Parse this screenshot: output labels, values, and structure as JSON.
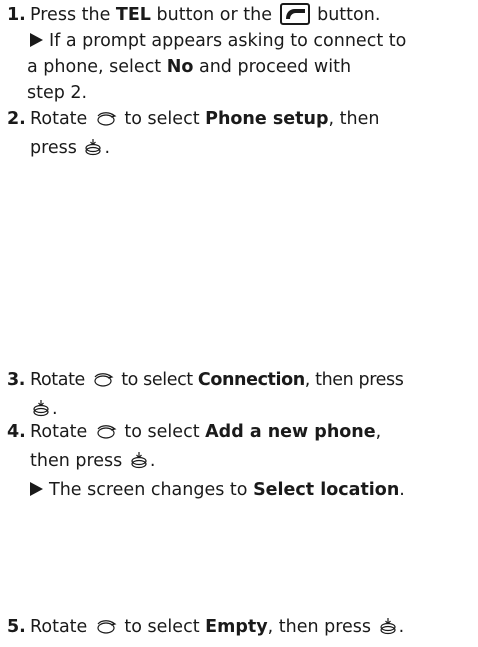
{
  "steps": {
    "s1": {
      "num": "1.",
      "a": "Press the ",
      "b": "TEL",
      "c": " button or the ",
      "d": " button."
    },
    "s1_note": {
      "l1": "If a prompt appears asking to connect to",
      "l2a": "a phone, select ",
      "l2b": "No",
      "l2c": " and proceed with",
      "l3": "step 2."
    },
    "s2": {
      "num": "2.",
      "a": "Rotate ",
      "b": " to select ",
      "c": "Phone setup",
      "d": ", then",
      "e": "press ",
      "f": "."
    },
    "s3": {
      "num": "3.",
      "a": "Rotate ",
      "b": " to select ",
      "c": "Connection",
      "d": ", then press",
      "e": "."
    },
    "s4": {
      "num": "4.",
      "a": "Rotate ",
      "b": " to select ",
      "c": "Add a new phone",
      "d": ",",
      "e": "then press ",
      "f": "."
    },
    "s4_note": {
      "a": "The screen changes to ",
      "b": "Select location",
      "c": "."
    },
    "s5": {
      "num": "5.",
      "a": "Rotate ",
      "b": " to select ",
      "c": "Empty",
      "d": ", then press ",
      "e": "."
    }
  },
  "icons": {
    "phone_button": "phone-button-icon",
    "knob": "interface-dial-rotate-icon",
    "press": "interface-dial-press-icon",
    "arrow": "triangle-bullet-icon"
  }
}
